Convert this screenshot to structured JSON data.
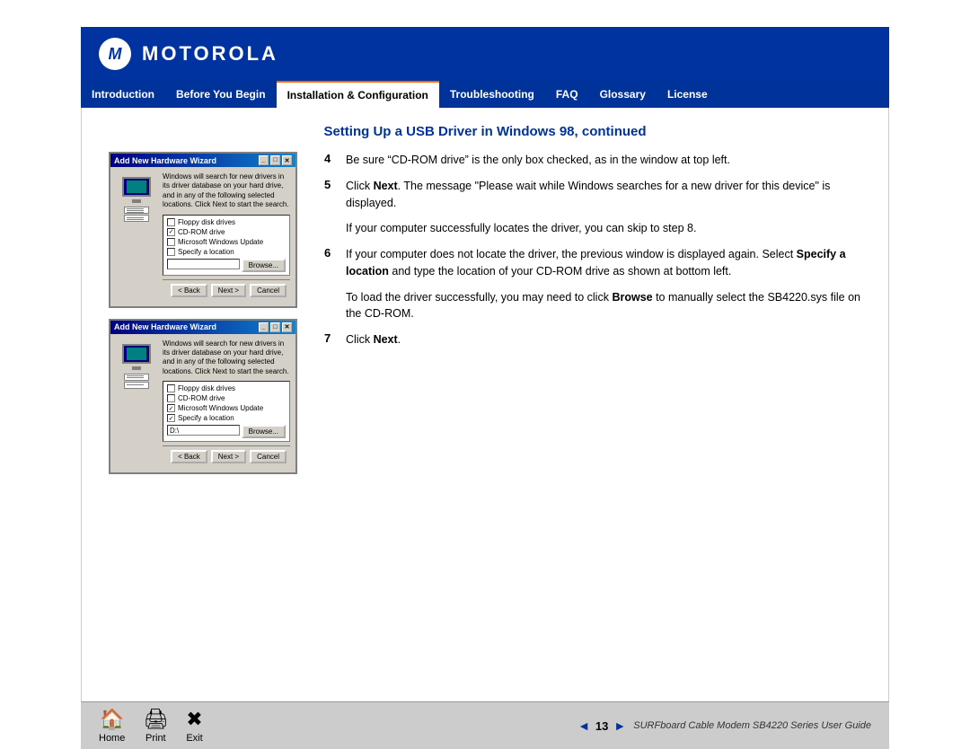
{
  "header": {
    "logo_text": "MOTOROLA",
    "logo_symbol": "M"
  },
  "nav": {
    "items": [
      {
        "label": "Introduction",
        "active": false
      },
      {
        "label": "Before You Begin",
        "active": false
      },
      {
        "label": "Installation & Configuration",
        "active": true
      },
      {
        "label": "Troubleshooting",
        "active": false
      },
      {
        "label": "FAQ",
        "active": false
      },
      {
        "label": "Glossary",
        "active": false
      },
      {
        "label": "License",
        "active": false
      }
    ]
  },
  "page": {
    "title": "Setting Up a USB Driver in Windows 98, continued",
    "wizard_title": "Add New Hardware Wizard"
  },
  "steps": [
    {
      "num": "4",
      "text": "Be sure “CD-ROM drive” is the only box checked, as in the window at top left."
    },
    {
      "num": "5",
      "text": "Click Next. The message “Please wait while Windows searches for a new driver for this device” is displayed."
    },
    {
      "num": "6",
      "text": "If your computer does not locate the driver, the previous window is displayed again. Select Specify a location and type the location of your CD-ROM drive as shown at bottom left."
    },
    {
      "num": "7",
      "text": "Click Next."
    }
  ],
  "body_texts": [
    "If your computer successfully locates the driver, you can skip to step 8.",
    "To load the driver successfully, you may need to click Browse to manually select the SB4220.sys file on the CD-ROM."
  ],
  "wizard": {
    "text": "Windows will search for new drivers in its driver database on your hard drive, and in any of the following selected locations. Click Next to start the search.",
    "checkboxes": [
      {
        "label": "Floppy disk drives",
        "checked": false
      },
      {
        "label": "CD-ROM drive",
        "checked": true
      },
      {
        "label": "Microsoft Windows Update",
        "checked": false
      },
      {
        "label": "Specify a location",
        "checked": false
      }
    ],
    "checkboxes_bottom": [
      {
        "label": "Floppy disk drives",
        "checked": false
      },
      {
        "label": "CD-ROM drive",
        "checked": false
      },
      {
        "label": "Microsoft Windows Update",
        "checked": true
      },
      {
        "label": "Specify a location",
        "checked": true
      }
    ],
    "location_value": "D:\\"
  },
  "footer": {
    "home_label": "Home",
    "print_label": "Print",
    "exit_label": "Exit",
    "page_number": "13",
    "guide_title": "SURFboard Cable Modem SB4220 Series User Guide"
  }
}
